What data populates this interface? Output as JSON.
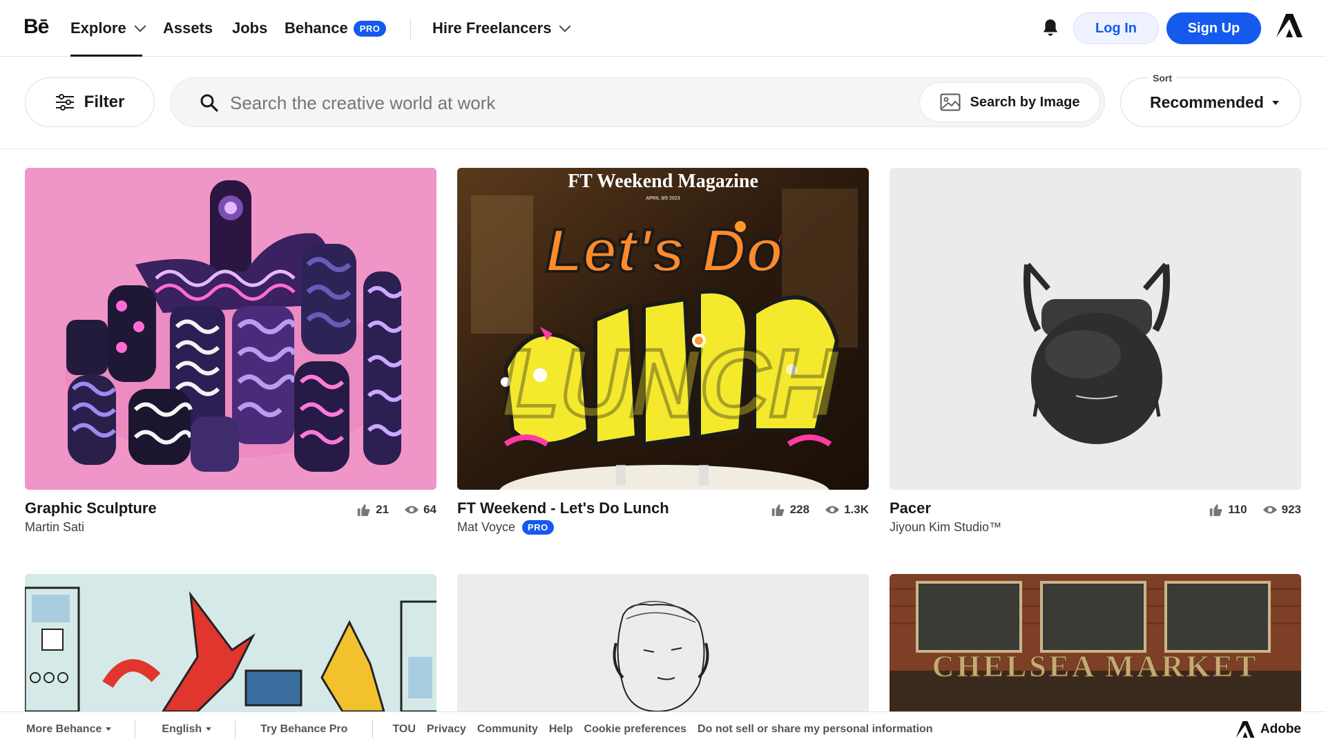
{
  "nav": {
    "logo": "Bē",
    "explore": "Explore",
    "assets": "Assets",
    "jobs": "Jobs",
    "behance": "Behance",
    "pro_badge": "PRO",
    "hire": "Hire Freelancers",
    "login": "Log In",
    "signup": "Sign Up"
  },
  "toolbar": {
    "filter": "Filter",
    "search_placeholder": "Search the creative world at work",
    "search_by_image": "Search by Image",
    "sort_label": "Sort",
    "sort_value": "Recommended"
  },
  "projects": [
    {
      "title": "Graphic Sculpture",
      "owner": "Martin Sati",
      "pro": false,
      "likes": "21",
      "views": "64"
    },
    {
      "title": "FT Weekend - Let's Do Lunch",
      "owner": "Mat Voyce",
      "pro": true,
      "pro_label": "PRO",
      "likes": "228",
      "views": "1.3K",
      "cover_magazine": "FT Weekend Magazine",
      "cover_date": "APRIL 8/9 2023",
      "cover_line1": "Let's Do",
      "cover_line2": "LUNCH"
    },
    {
      "title": "Pacer",
      "owner": "Jiyoun Kim Studio™",
      "pro": false,
      "likes": "110",
      "views": "923"
    },
    {
      "title": "",
      "owner": ""
    },
    {
      "title": "",
      "owner": ""
    },
    {
      "title": "",
      "owner": "",
      "cover_sign": "CHELSEA MARKET"
    }
  ],
  "footer": {
    "more_behance": "More Behance",
    "language": "English",
    "try_pro": "Try Behance Pro",
    "tou": "TOU",
    "privacy": "Privacy",
    "community": "Community",
    "help": "Help",
    "cookies": "Cookie preferences",
    "do_not_sell": "Do not sell or share my personal information",
    "adobe": "Adobe"
  },
  "colors": {
    "accent": "#1559ed",
    "text": "#191919"
  },
  "icons": [
    "bell-icon",
    "adobe-icon",
    "filter-icon",
    "search-icon",
    "image-icon",
    "thumbs-up-icon",
    "eye-icon"
  ]
}
